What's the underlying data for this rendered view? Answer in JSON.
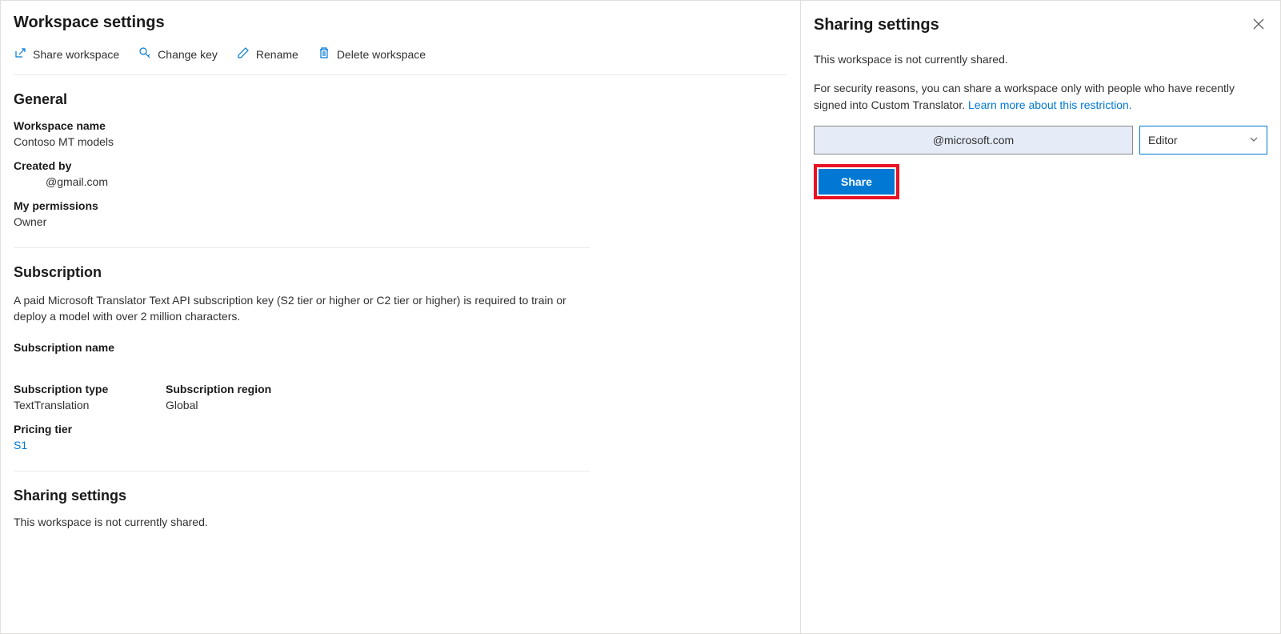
{
  "main": {
    "title": "Workspace settings",
    "toolbar": {
      "share": "Share workspace",
      "change_key": "Change key",
      "rename": "Rename",
      "delete": "Delete workspace"
    },
    "general": {
      "title": "General",
      "workspace_name_label": "Workspace name",
      "workspace_name_value": "Contoso MT models",
      "created_by_label": "Created by",
      "created_by_value": "@gmail.com",
      "my_permissions_label": "My permissions",
      "my_permissions_value": "Owner"
    },
    "subscription": {
      "title": "Subscription",
      "description": "A paid Microsoft Translator Text API subscription key (S2 tier or higher or C2 tier or higher) is required to train or deploy a model with over 2 million characters.",
      "name_label": "Subscription name",
      "type_label": "Subscription type",
      "type_value": "TextTranslation",
      "region_label": "Subscription region",
      "region_value": "Global",
      "pricing_label": "Pricing tier",
      "pricing_value": "S1"
    },
    "sharing": {
      "title": "Sharing settings",
      "status": "This workspace is not currently shared."
    }
  },
  "panel": {
    "title": "Sharing settings",
    "status": "This workspace is not currently shared.",
    "security_text": "For security reasons, you can share a workspace only with people who have recently signed into Custom Translator. ",
    "learn_more": "Learn more about this restriction.",
    "email_value": "@microsoft.com",
    "role_value": "Editor",
    "share_button": "Share"
  }
}
